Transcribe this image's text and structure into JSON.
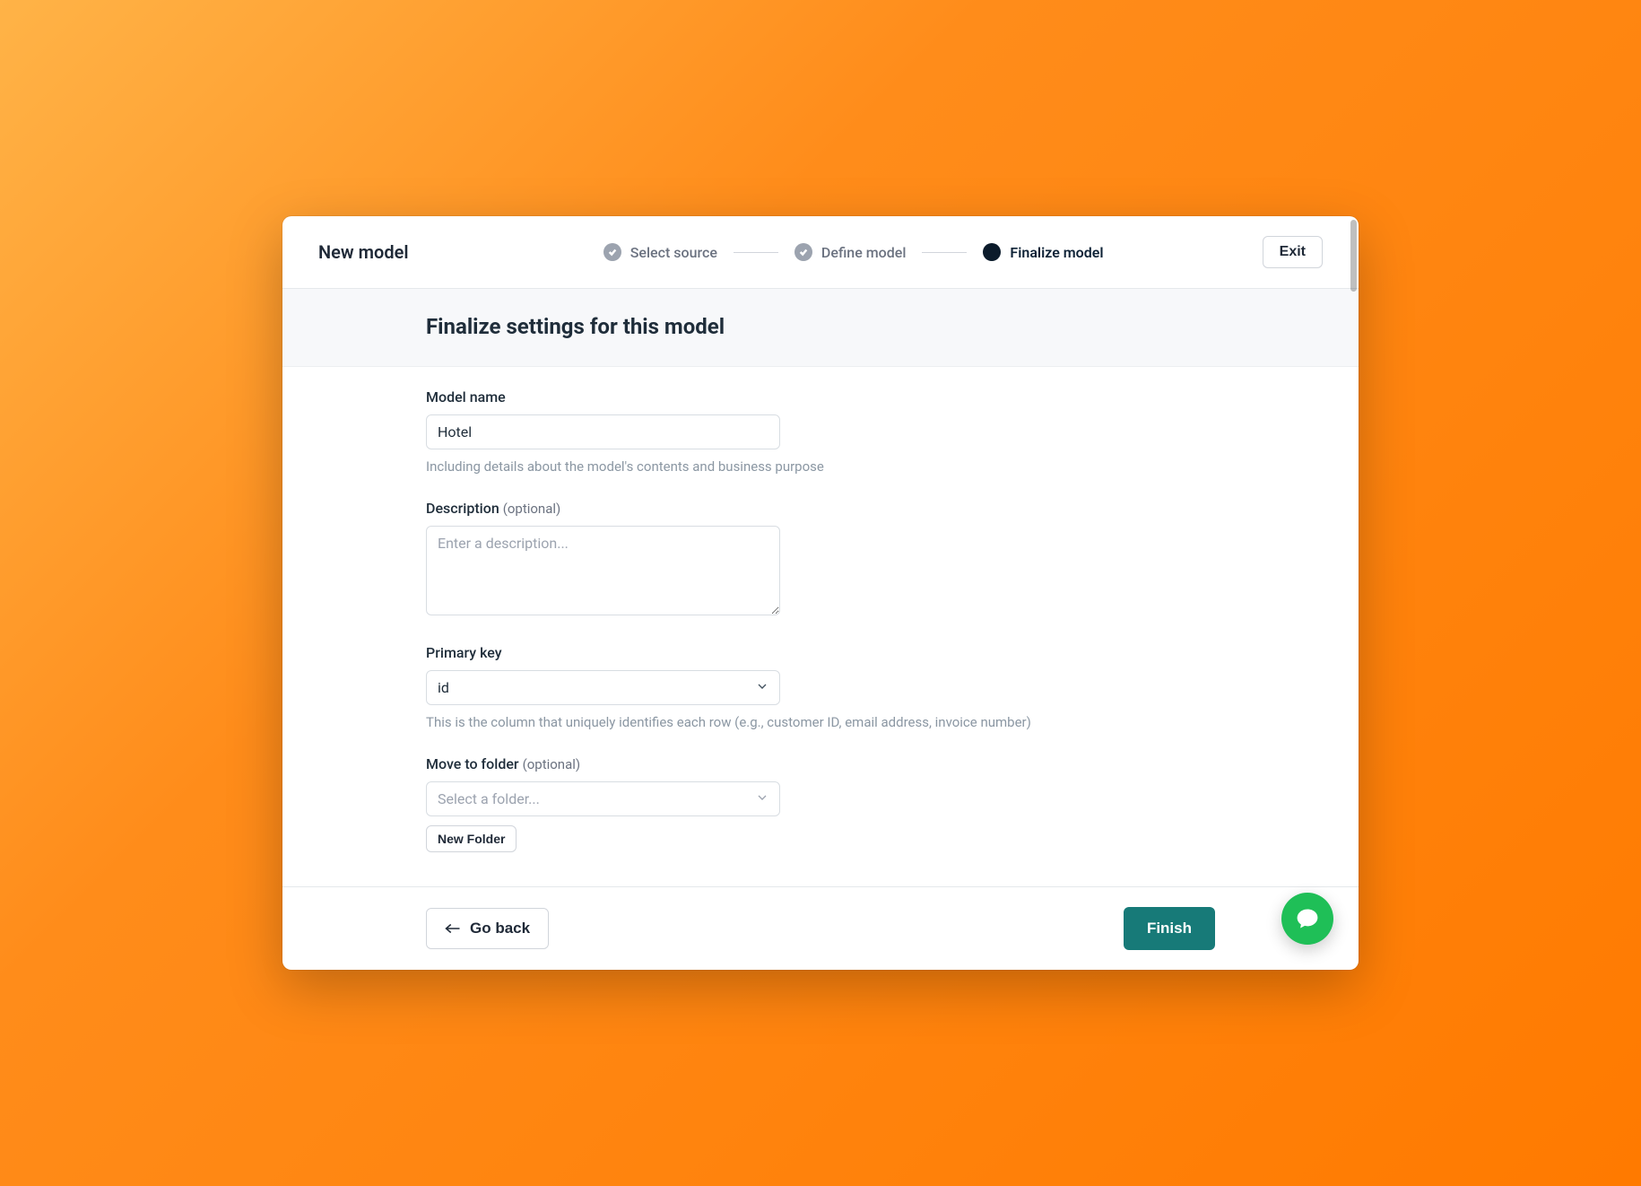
{
  "header": {
    "title": "New model",
    "steps": [
      {
        "label": "Select source",
        "state": "done"
      },
      {
        "label": "Define model",
        "state": "done"
      },
      {
        "label": "Finalize model",
        "state": "active"
      }
    ],
    "exit_label": "Exit"
  },
  "subheader": {
    "heading": "Finalize settings for this model"
  },
  "form": {
    "model_name": {
      "label": "Model name",
      "value": "Hotel",
      "helper": "Including details about the model's contents and business purpose"
    },
    "description": {
      "label": "Description",
      "optional_label": "(optional)",
      "placeholder": "Enter a description...",
      "value": ""
    },
    "primary_key": {
      "label": "Primary key",
      "value": "id",
      "helper": "This is the column that uniquely identifies each row (e.g., customer ID, email address, invoice number)"
    },
    "folder": {
      "label": "Move to folder",
      "optional_label": "(optional)",
      "placeholder": "Select a folder...",
      "new_folder_label": "New Folder"
    }
  },
  "footer": {
    "back_label": "Go back",
    "finish_label": "Finish"
  }
}
